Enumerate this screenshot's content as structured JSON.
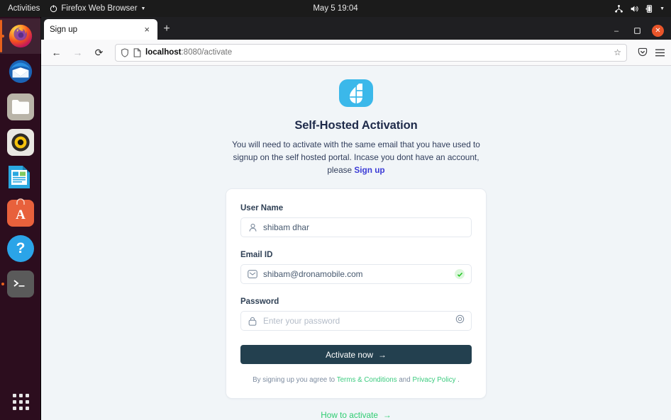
{
  "system": {
    "activities": "Activities",
    "app_menu": "Firefox Web Browser",
    "clock": "May 5  19:04",
    "tray": [
      "network-icon",
      "volume-icon",
      "battery-icon",
      "chevron-down-icon"
    ]
  },
  "dock": {
    "items": [
      {
        "name": "firefox",
        "label": "Firefox Web Browser",
        "active": true,
        "running": true
      },
      {
        "name": "thunderbird",
        "label": "Thunderbird Mail",
        "active": false,
        "running": false
      },
      {
        "name": "files",
        "label": "Files",
        "active": false,
        "running": false
      },
      {
        "name": "rhythmbox",
        "label": "Rhythmbox",
        "active": false,
        "running": false
      },
      {
        "name": "libreoffice-writer",
        "label": "LibreOffice Writer",
        "active": false,
        "running": false
      },
      {
        "name": "ubuntu-software",
        "label": "Ubuntu Software",
        "active": false,
        "running": false
      },
      {
        "name": "help",
        "label": "Help",
        "active": false,
        "running": false
      },
      {
        "name": "terminal",
        "label": "Terminal",
        "active": false,
        "running": true
      }
    ],
    "show_apps": "Show Applications"
  },
  "browser": {
    "tab_title": "Sign up",
    "tab_close": "×",
    "new_tab": "+",
    "back": "←",
    "forward": "→",
    "reload": "⟳",
    "url_host": "localhost",
    "url_rest": ":8080/activate",
    "bookmark": "☆",
    "minimize": "–",
    "maximize": "❐",
    "close": "✕"
  },
  "page": {
    "logo_name": "dronamobile-logo",
    "title": "Self-Hosted Activation",
    "subtitle_part1": "You will need to activate with the same email that you have used to signup on the self hosted portal. Incase you dont have an account, please ",
    "subtitle_link": "Sign up",
    "form": {
      "username": {
        "label": "User Name",
        "value": "shibam dhar",
        "icon": "user-icon"
      },
      "email": {
        "label": "Email ID",
        "value": "shibam@dronamobile.com",
        "icon": "envelope-icon",
        "verified": true,
        "check": "✓"
      },
      "password": {
        "label": "Password",
        "value": "",
        "placeholder": "Enter your password",
        "icon": "lock-icon",
        "toggle_icon": "eye-icon"
      },
      "submit_label": "Activate now",
      "submit_arrow": "→"
    },
    "legal_prefix": "By signing up you agree to ",
    "legal_terms": "Terms & Conditions",
    "legal_and": " and ",
    "legal_privacy": "Privacy Policy",
    "legal_suffix": " ."
  },
  "footer": {
    "how_to_label": "How to activate",
    "how_to_arrow": "→"
  },
  "colors": {
    "page_bg": "#f1f5f8",
    "logo_bg": "#3bb8ea",
    "title": "#1e2a4a",
    "signup_link": "#3b3bd6",
    "button": "#23404f",
    "green_link": "#3ccb7f",
    "how_to_green": "#2ecc71",
    "check_bg": "#dcf7dc",
    "close_btn": "#e9552a",
    "dock_bg": "#2c0d1e"
  }
}
